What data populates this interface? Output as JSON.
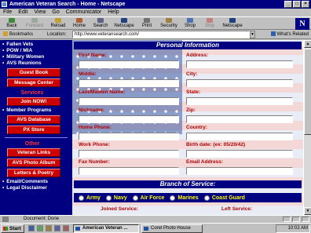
{
  "window": {
    "title": "American Veteran Search - Home - Netscape"
  },
  "menu": [
    "File",
    "Edit",
    "View",
    "Go",
    "Communicator",
    "Help"
  ],
  "toolbar": {
    "back": "Back",
    "forward": "Forward",
    "reload": "Reload",
    "home": "Home",
    "search": "Search",
    "netscape": "Netscape",
    "print": "Print",
    "security": "Security",
    "shop": "Shop",
    "stop": "Stop",
    "netscape2": "Netscape"
  },
  "location": {
    "bookmarks": "Bookmarks",
    "label": "Location:",
    "url": "http://www.veteransearch.com/",
    "related": "What's Related"
  },
  "sidebar": {
    "links_top": [
      "Fallen Vets",
      "POW / MIA",
      "Military Women",
      "AVS Reunions"
    ],
    "btn_guestbook": "Guest Book",
    "btn_message_center": "Message Center",
    "services_heading": "Services",
    "btn_join": "Join NOW!",
    "link_member_programs": "Member Programs",
    "btn_database": "AVS Database",
    "btn_px_store": "PX Store",
    "other_heading": "Other",
    "btn_veteran_links": "Veteran Links",
    "btn_photo_album": "AVS Photo Album",
    "btn_letters": "Letters & Poetry",
    "links_bottom": [
      "Email/Comments",
      "Legal Disclaimer"
    ]
  },
  "form": {
    "personal_header": "Personal Information",
    "labels": {
      "first_name": "First Name:",
      "address": "Address:",
      "middle": "Middle:",
      "city": "City:",
      "last_name": "Last/Maiden Name:",
      "state": "State:",
      "nickname": "Nickname:",
      "zip": "Zip:",
      "home_phone": "Home Phone:",
      "country": "Country:",
      "work_phone": "Work Phone:",
      "birth_date": "Birth date: (ex: 05/20/42)",
      "fax": "Fax Number:",
      "email": "Email Address:"
    },
    "branch_header": "Branch of Service:",
    "branches": [
      "Army",
      "Navy",
      "Air Force",
      "Marines",
      "Coast Guard"
    ],
    "joined_service": "Joined Service:",
    "left_service": "Left Service:"
  },
  "status": {
    "text": "Document: Done"
  },
  "taskbar": {
    "start": "Start",
    "tasks": [
      "American Veteran ...",
      "Corel Photo House"
    ],
    "clock": "10:02 AM"
  },
  "colors": {
    "sidebar_bg": "#000080",
    "label_red": "#b00000",
    "button_red": "#cc0000",
    "branch_text": "#ffff00"
  }
}
